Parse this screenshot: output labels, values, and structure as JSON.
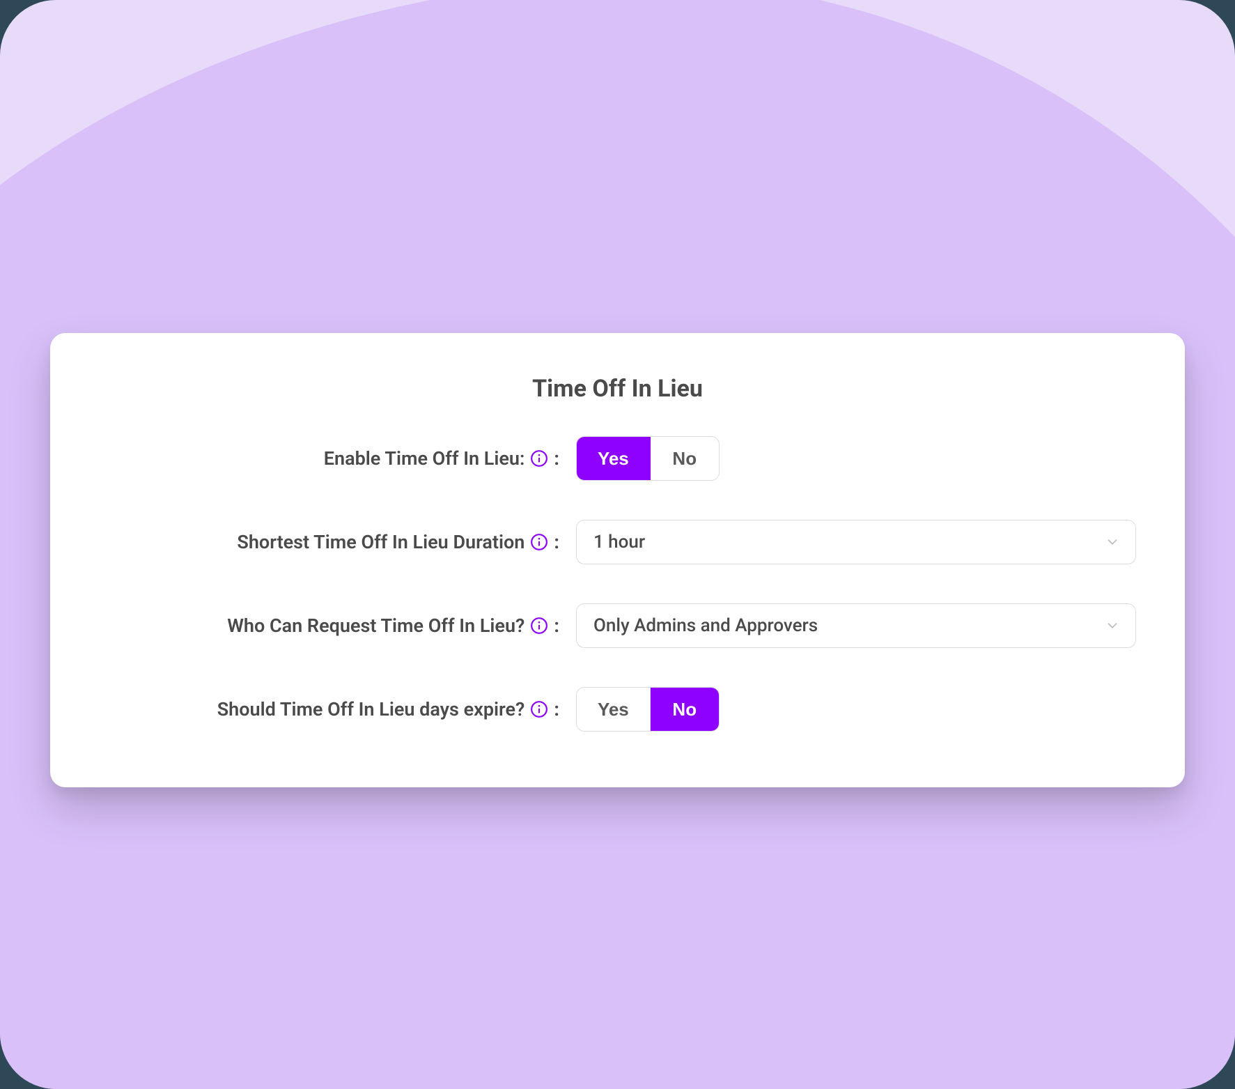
{
  "card": {
    "title": "Time Off In Lieu",
    "rows": {
      "enable": {
        "label": "Enable Time Off In Lieu:",
        "yes": "Yes",
        "no": "No",
        "selected": "yes"
      },
      "shortest": {
        "label": "Shortest Time Off In Lieu Duration",
        "value": "1 hour"
      },
      "who": {
        "label": "Who Can Request Time Off In Lieu?",
        "value": "Only Admins and Approvers"
      },
      "expire": {
        "label": "Should Time Off In Lieu days expire?",
        "yes": "Yes",
        "no": "No",
        "selected": "no"
      }
    },
    "colon": ":"
  },
  "colors": {
    "accent": "#8e00ff",
    "bg_light": "#e8dbfa",
    "bg_mid": "#d9c0f9",
    "text": "#4a4a4a",
    "border": "#dcdcdc"
  }
}
